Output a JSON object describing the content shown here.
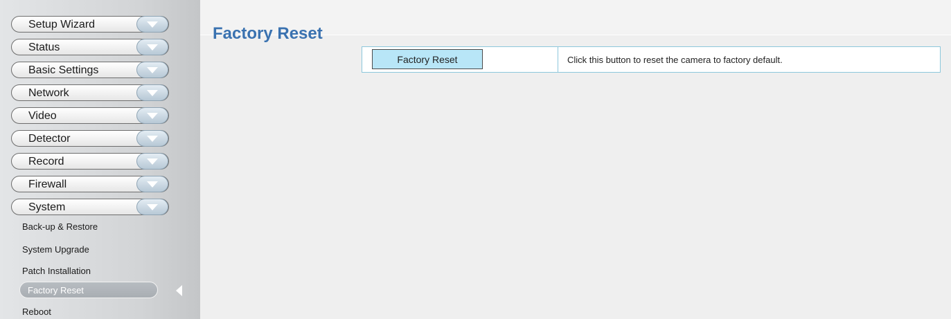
{
  "sidebar": {
    "menus": [
      {
        "label": "Setup Wizard"
      },
      {
        "label": "Status"
      },
      {
        "label": "Basic Settings"
      },
      {
        "label": "Network"
      },
      {
        "label": "Video"
      },
      {
        "label": "Detector"
      },
      {
        "label": "Record"
      },
      {
        "label": "Firewall"
      },
      {
        "label": "System"
      }
    ],
    "system_items": [
      {
        "label": "Back-up & Restore"
      },
      {
        "label": "System Upgrade"
      },
      {
        "label": "Patch Installation"
      },
      {
        "label": "Factory Reset",
        "active": true
      },
      {
        "label": "Reboot"
      }
    ]
  },
  "main": {
    "title": "Factory Reset",
    "reset_button_label": "Factory Reset",
    "reset_description": "Click this button to reset the camera to factory default."
  },
  "icons": {
    "menu_expand": "chevron-down-icon",
    "active_marker": "arrow-left-icon"
  },
  "colors": {
    "title": "#3a72b0",
    "button_bg": "#b8e6f7",
    "table_border": "#8cc7dc",
    "active_item_bg": "#aeb3b8"
  }
}
